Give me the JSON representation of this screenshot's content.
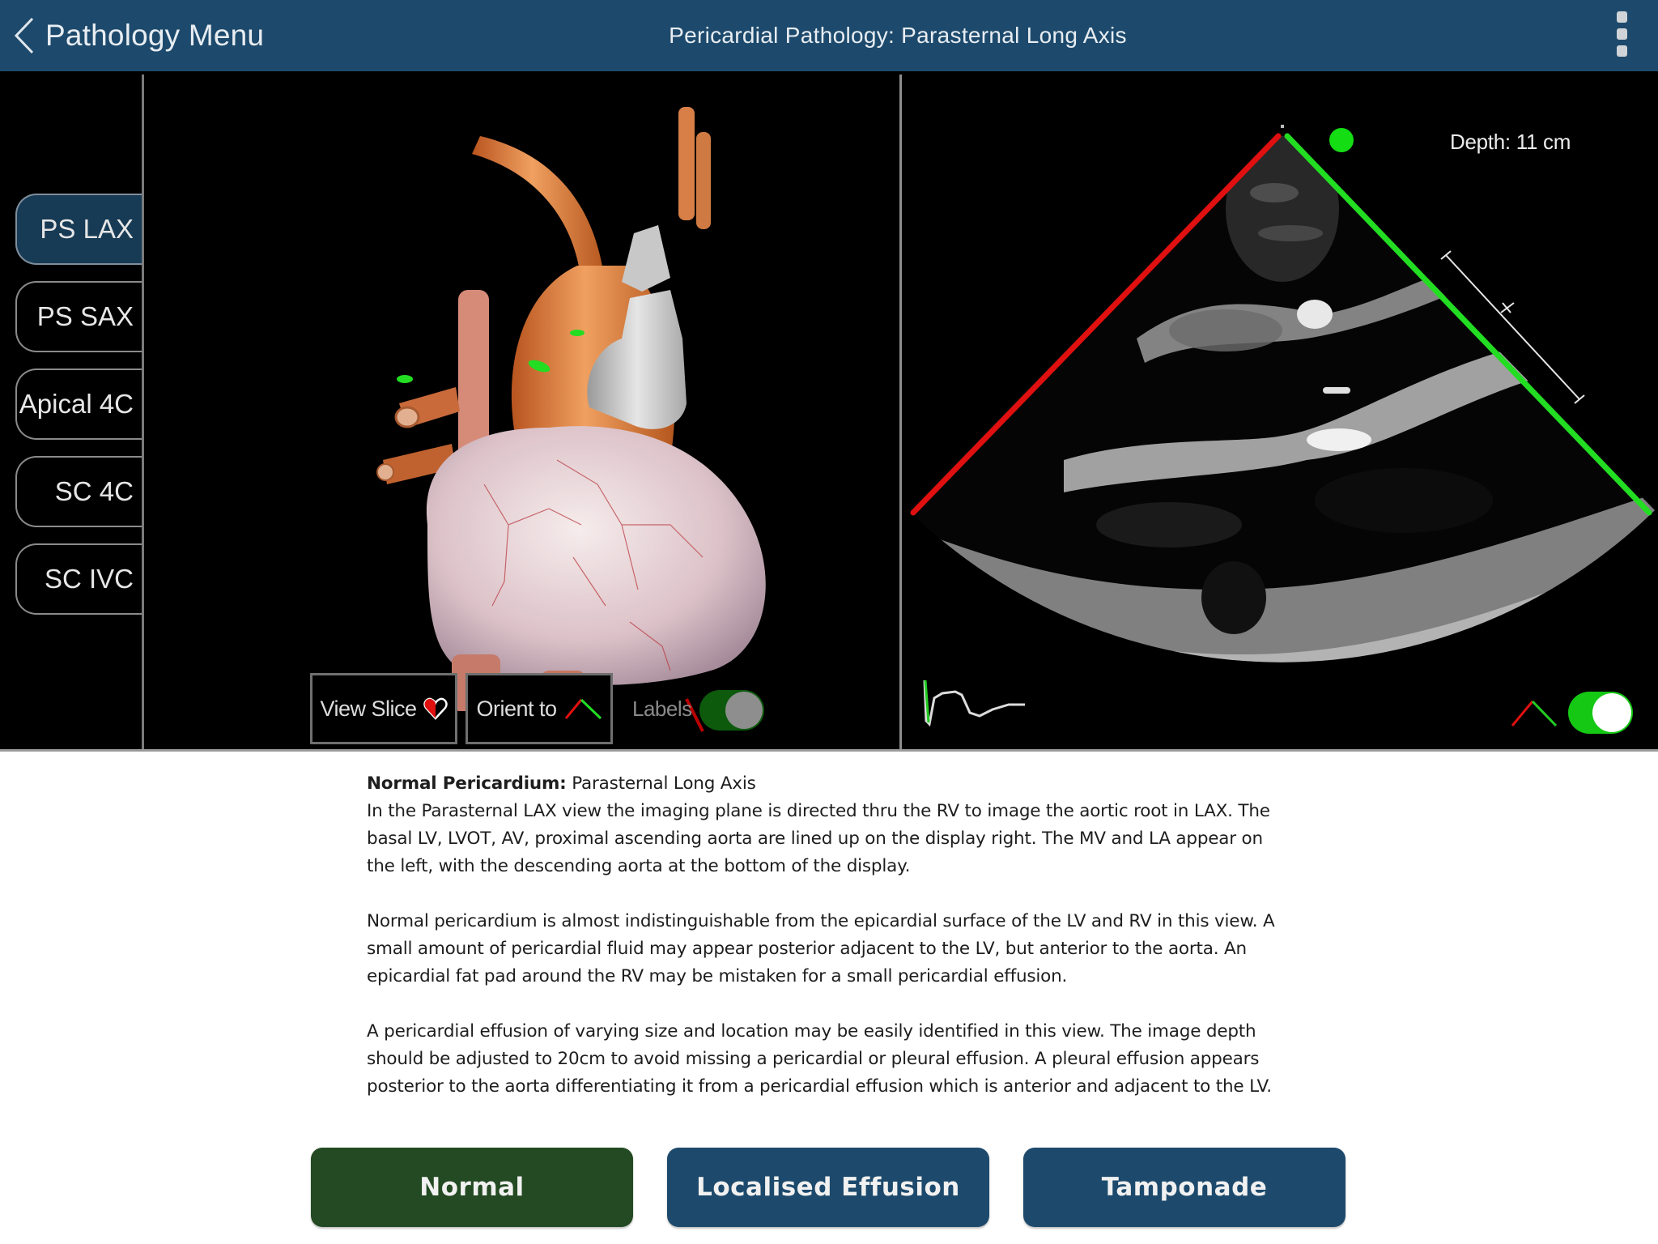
{
  "navbar": {
    "back_label": "Pathology Menu",
    "title": "Pericardial Pathology: Parasternal Long Axis",
    "back_icon": "chevron-left-icon",
    "menu_icon": "kebab-menu-icon"
  },
  "view_tabs": [
    {
      "label": "PS LAX",
      "active": true
    },
    {
      "label": "PS SAX",
      "active": false
    },
    {
      "label": "Apical 4C",
      "active": false
    },
    {
      "label": "SC 4C",
      "active": false
    },
    {
      "label": "SC IVC",
      "active": false
    }
  ],
  "heart_panel": {
    "view_slice_label": "View Slice",
    "view_slice_icon": "half-heart-icon",
    "orient_label": "Orient to",
    "orient_icon": "red-green-sector-icon",
    "labels_label": "Labels",
    "labels_toggle_on": true
  },
  "echo_panel": {
    "depth_label": "Depth: 11 cm",
    "orientation_marker": "green-dot",
    "sector_toggle_on": true
  },
  "description": {
    "title_bold": "Normal Pericardium:",
    "title_rest": " Parasternal Long Axis",
    "paragraphs": [
      "In the Parasternal LAX view the imaging plane is directed thru the RV to image the aortic root in LAX. The basal LV, LVOT, AV, proximal ascending aorta are lined up on the display right. The MV and LA appear on the left, with the descending aorta at the bottom of the display.",
      "Normal pericardium is almost indistinguishable from the epicardial surface of the LV and RV in this view. A small amount of pericardial fluid may appear posterior adjacent to the LV, but anterior to the aorta. An epicardial fat pad around the RV may be mistaken for a small pericardial effusion.",
      "A pericardial effusion of varying size and location may be easily identified in this view. The image depth should be adjusted to 20cm to avoid missing a pericardial or pleural effusion. A pleural effusion appears posterior to the aorta differentiating it from a pericardial effusion which is anterior and adjacent to the LV."
    ]
  },
  "pathology_buttons": [
    {
      "label": "Normal",
      "selected": true
    },
    {
      "label": "Localised Effusion",
      "selected": false
    },
    {
      "label": "Tamponade",
      "selected": false
    }
  ],
  "colors": {
    "navbar": "#1d4a6c",
    "selected_button": "#234a22",
    "sector_left": "#e01010",
    "sector_right": "#22dd22"
  }
}
